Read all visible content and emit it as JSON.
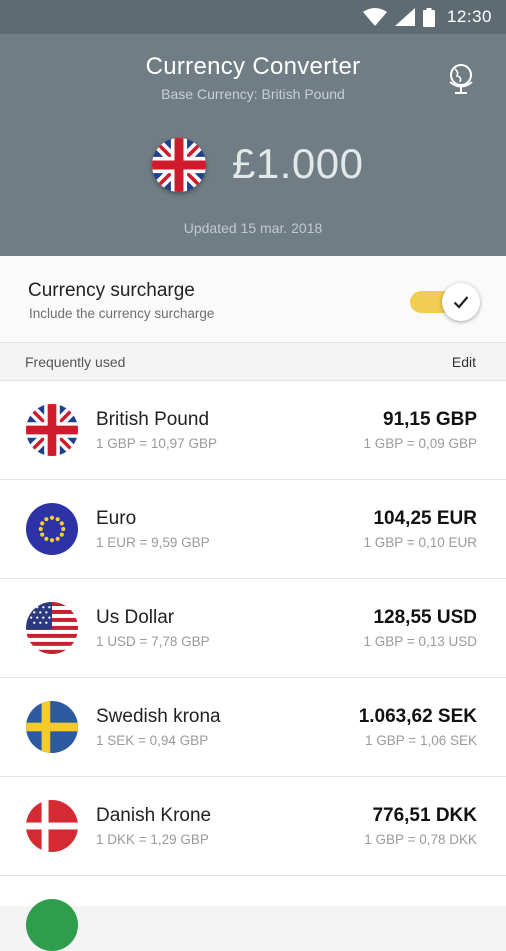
{
  "status_bar": {
    "time": "12:30",
    "icons": [
      "wifi-icon",
      "signal-icon",
      "battery-icon"
    ]
  },
  "header": {
    "title": "Currency Converter",
    "subtitle": "Base Currency: British Pound",
    "amount": "£1.000",
    "updated": "Updated 15 mar. 2018",
    "base_flag": "uk-flag",
    "action_icon": "globe-icon"
  },
  "surcharge": {
    "title": "Currency surcharge",
    "description": "Include the currency surcharge",
    "enabled": true
  },
  "section": {
    "label": "Frequently used",
    "edit_label": "Edit"
  },
  "currencies": [
    {
      "name": "British Pound",
      "rate": "1 GBP = 10,97 GBP",
      "value": "91,15 GBP",
      "inverse": "1 GBP = 0,09 GBP",
      "flag": "uk-flag"
    },
    {
      "name": "Euro",
      "rate": "1 EUR = 9,59 GBP",
      "value": "104,25 EUR",
      "inverse": "1 GBP = 0,10 EUR",
      "flag": "eu-flag"
    },
    {
      "name": "Us Dollar",
      "rate": "1 USD = 7,78 GBP",
      "value": "128,55 USD",
      "inverse": "1 GBP = 0,13 USD",
      "flag": "us-flag"
    },
    {
      "name": "Swedish krona",
      "rate": "1 SEK = 0,94 GBP",
      "value": "1.063,62 SEK",
      "inverse": "1 GBP = 1,06 SEK",
      "flag": "se-flag"
    },
    {
      "name": "Danish Krone",
      "rate": "1 DKK = 1,29 GBP",
      "value": "776,51 DKK",
      "inverse": "1 GBP = 0,78 DKK",
      "flag": "dk-flag"
    }
  ],
  "colors": {
    "status_bar": "#5e6b73",
    "header": "#707d84",
    "toggle_on": "#f3cd53"
  }
}
